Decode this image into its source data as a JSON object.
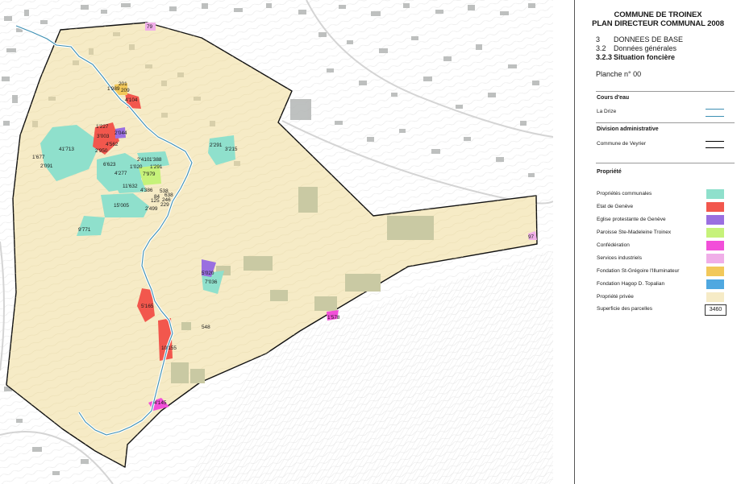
{
  "legend": {
    "title_line1": "COMMUNE DE TROINEX",
    "title_line2": "PLAN DIRECTEUR COMMUNAL 2008",
    "sections": [
      {
        "num": "3",
        "text": "DONNEES DE BASE"
      },
      {
        "num": "3.2",
        "text": "Données générales"
      },
      {
        "num": "3.2.3",
        "text": "Situation foncière"
      }
    ],
    "plan_label": "Planche n° 00",
    "cours_deau": {
      "heading": "Cours d'eau",
      "item": "La Drize",
      "color": "#3c8fb3"
    },
    "division": {
      "heading": "Division administrative",
      "item": "Commune de Veyrier",
      "color": "#000000"
    },
    "propriete": {
      "heading": "Propriété",
      "items": [
        {
          "label": "Propriétés communales",
          "color": "#8fe0cc"
        },
        {
          "label": "Etat de Genève",
          "color": "#f2574d"
        },
        {
          "label": "Eglise protestante de Genève",
          "color": "#9a6fe0"
        },
        {
          "label": "Paroisse Ste-Madeleine Troinex",
          "color": "#c6f27a"
        },
        {
          "label": "Confédération",
          "color": "#f24fd9"
        },
        {
          "label": "Services industriels",
          "color": "#f0aee8"
        },
        {
          "label": "Fondation St-Grégoire l'Illuminateur",
          "color": "#f2c85a"
        },
        {
          "label": "Fondation Hagop D. Topalian",
          "color": "#4fa8e0"
        },
        {
          "label": "Propriété privée",
          "color": "#f6ebc6"
        }
      ],
      "area_item": {
        "label": "Superficie des parcelles",
        "value": "3460"
      }
    }
  },
  "map": {
    "parcel_labels": [
      "79",
      "201",
      "209",
      "1'989",
      "4'104",
      "1'227",
      "3'003",
      "2'044",
      "4'562",
      "2'950",
      "41'713",
      "1'677",
      "2'091",
      "6'623",
      "2'410",
      "1'388",
      "1'020",
      "1'291",
      "4'277",
      "7'979",
      "11'632",
      "4'386",
      "538",
      "638",
      "84",
      "246",
      "125",
      "229",
      "2'499",
      "15'005",
      "9'771",
      "2'291",
      "3'215",
      "97",
      "5'020",
      "7'036",
      "5'165",
      "548",
      "1'578",
      "10'155",
      "4'145"
    ]
  }
}
